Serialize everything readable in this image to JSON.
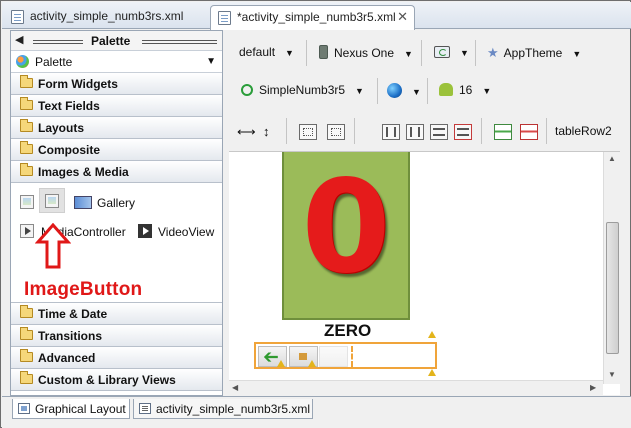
{
  "editor_tabs": [
    {
      "label": "activity_simple_numb3rs.xml",
      "active": false
    },
    {
      "label": "*activity_simple_numb3r5.xml",
      "active": true
    }
  ],
  "palette": {
    "title": "Palette",
    "selector_label": "Palette",
    "categories_top": [
      "Form Widgets",
      "Text Fields",
      "Layouts",
      "Composite",
      "Images & Media"
    ],
    "images_media_items": [
      "Gallery",
      "MediaController",
      "VideoView"
    ],
    "categories_bottom": [
      "Time & Date",
      "Transitions",
      "Advanced",
      "Custom & Library Views"
    ]
  },
  "annotation": {
    "text": "ImageButton",
    "color": "#e01818"
  },
  "toolbar": {
    "config": "default",
    "device": "Nexus One",
    "theme": "AppTheme",
    "activity": "SimpleNumb3r5",
    "api_level": "16",
    "selected_element": "tableRow2"
  },
  "preview": {
    "big_digit": "0",
    "label": "ZERO",
    "card_color": "#9bbb59",
    "digit_color": "#e51b1b"
  },
  "bottom_tabs": [
    {
      "label": "Graphical Layout",
      "active": true
    },
    {
      "label": "activity_simple_numb3r5.xml",
      "active": false
    }
  ],
  "icons": [
    "file-icon",
    "close-icon",
    "left-arrow-icon",
    "palette-icon",
    "dropdown-icon",
    "folder-icon",
    "imageview-icon",
    "imagebutton-icon",
    "gallery-icon",
    "mediacontroller-icon",
    "videoview-icon",
    "up-arrow-icon",
    "phone-icon",
    "refresh-icon",
    "star-icon",
    "activity-icon",
    "globe-icon",
    "android-icon",
    "warning-icon",
    "back-arrow-icon",
    "speaker-icon"
  ]
}
